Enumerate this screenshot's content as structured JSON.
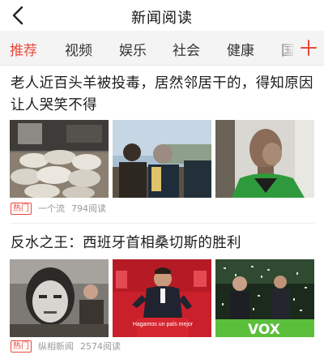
{
  "header": {
    "title": "新闻阅读",
    "back_icon": "back-chevron-icon"
  },
  "tabs": [
    {
      "label": "推荐",
      "active": true
    },
    {
      "label": "视频",
      "active": false
    },
    {
      "label": "娱乐",
      "active": false
    },
    {
      "label": "社会",
      "active": false
    },
    {
      "label": "健康",
      "active": false
    },
    {
      "label": "国",
      "active": false
    }
  ],
  "tabs_add_icon": "plus-icon",
  "colors": {
    "accent": "#e8483a",
    "tab_bar_bg": "#f4f4f4"
  },
  "articles": [
    {
      "headline": "老人近百头羊被投毒，居然邻居干的，得知原因让人哭笑不得",
      "badge": "热门",
      "source": "一个流",
      "reads": "794阅读",
      "images": [
        "sheep-barn-photo",
        "men-outdoors-blurred-photo",
        "man-green-vest-blurred-photo"
      ]
    },
    {
      "headline": "反水之王：西班牙首相桑切斯的胜利",
      "badge": "热门",
      "source": "纵相新闻",
      "reads": "2574阅读",
      "images": [
        "sanchez-mural-photo",
        "sanchez-podium-photo",
        "vox-rally-confetti-photo"
      ],
      "image_text": {
        "podium_banner": "Hagamos un país mejor",
        "vox_banner": "VOX"
      }
    }
  ]
}
